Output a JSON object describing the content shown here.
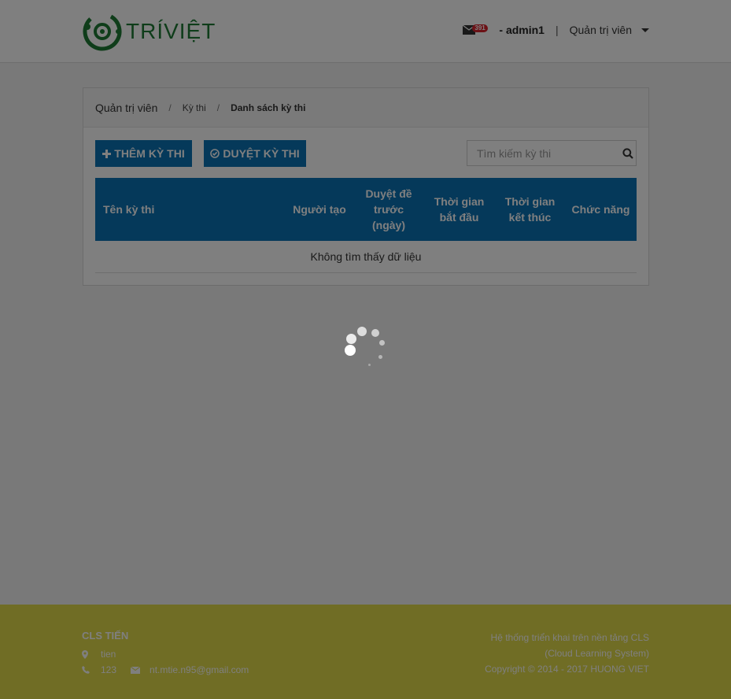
{
  "header": {
    "logo_text": "TRÍVIỆT",
    "mail_count": "391",
    "user": "- admin1",
    "separator": "|",
    "role": "Quản trị viên"
  },
  "breadcrumb": {
    "items": [
      "Quản trị viên",
      "Kỳ thi",
      "Danh sách kỳ thi"
    ],
    "separator": "/"
  },
  "toolbar": {
    "add_label": "THÊM KỲ THI",
    "approve_label": "DUYỆT KỲ THI",
    "search_placeholder": "Tìm kiếm kỳ thi"
  },
  "table": {
    "columns": [
      "Tên kỳ thi",
      "Người tạo",
      "Duyệt đề trước (ngày)",
      "Thời gian bắt đầu",
      "Thời gian kết thúc",
      "Chức năng"
    ],
    "empty_text": "Không tìm thấy dữ liệu"
  },
  "footer": {
    "title": "CLS TIẾN",
    "address": "tien",
    "phone": "123",
    "email": "nt.mtie.n95@gmail.com",
    "right_lines": [
      "Hệ thống triển khai trên nền tảng CLS",
      "(Cloud Learning System)",
      "Copyright © 2014 - 2017 HUONG VIET"
    ]
  },
  "colors": {
    "primary": "#0a72b5",
    "brand_green": "#1e7a35",
    "footer": "#e0db4a",
    "badge": "#d9232d"
  }
}
